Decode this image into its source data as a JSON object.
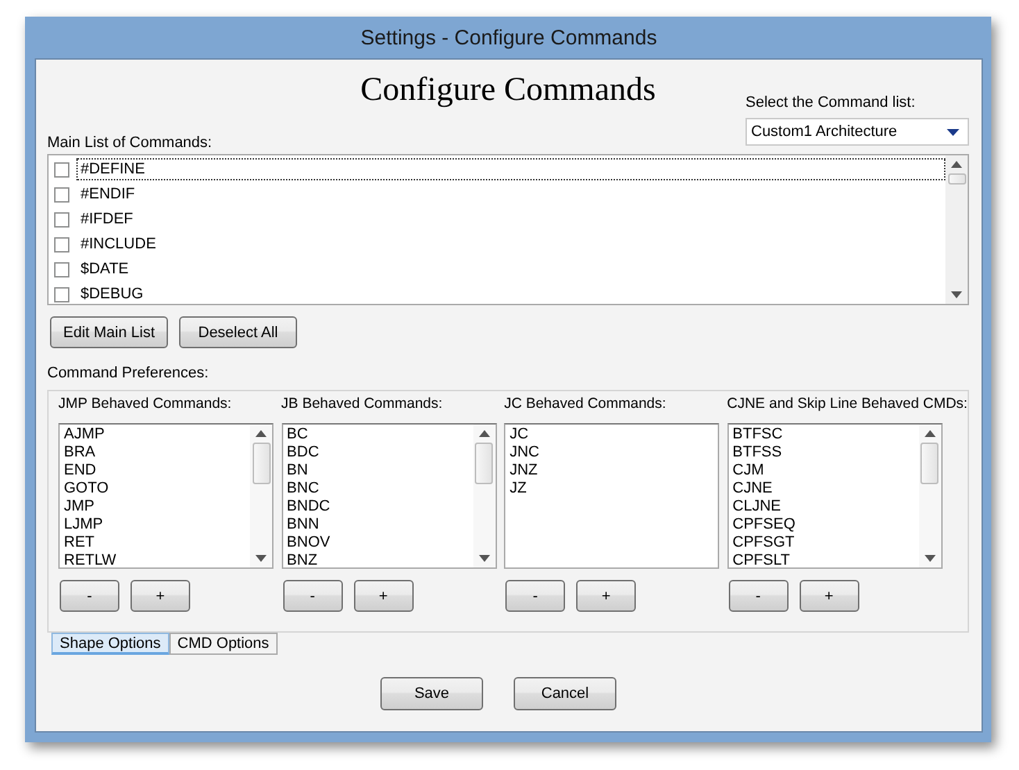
{
  "window": {
    "title": "Settings - Configure Commands"
  },
  "heading": "Configure Commands",
  "command_list": {
    "label": "Select the Command list:",
    "value": "Custom1 Architecture"
  },
  "main_list": {
    "label": "Main List of Commands:",
    "items": [
      {
        "label": "#DEFINE",
        "checked": false,
        "focused": true
      },
      {
        "label": "#ENDIF",
        "checked": false,
        "focused": false
      },
      {
        "label": "#IFDEF",
        "checked": false,
        "focused": false
      },
      {
        "label": "#INCLUDE",
        "checked": false,
        "focused": false
      },
      {
        "label": "$DATE",
        "checked": false,
        "focused": false
      },
      {
        "label": "$DEBUG",
        "checked": false,
        "focused": false
      }
    ]
  },
  "main_buttons": [
    "Edit Main List",
    "Deselect All"
  ],
  "preferences": {
    "label": "Command Preferences:",
    "groups": [
      {
        "title": "JMP Behaved Commands:",
        "scrollable": true,
        "items": [
          "AJMP",
          "BRA",
          "END",
          "GOTO",
          "JMP",
          "LJMP",
          "RET",
          "RETLW"
        ],
        "buttons": [
          "-",
          "+"
        ]
      },
      {
        "title": "JB Behaved Commands:",
        "scrollable": true,
        "items": [
          "BC",
          "BDC",
          "BN",
          "BNC",
          "BNDC",
          "BNN",
          "BNOV",
          "BNZ"
        ],
        "buttons": [
          "-",
          "+"
        ]
      },
      {
        "title": "JC Behaved Commands:",
        "scrollable": false,
        "items": [
          "JC",
          "JNC",
          "JNZ",
          "JZ"
        ],
        "buttons": [
          "-",
          "+"
        ]
      },
      {
        "title": "CJNE and Skip Line Behaved CMDs:",
        "scrollable": true,
        "items": [
          "BTFSC",
          "BTFSS",
          "CJM",
          "CJNE",
          "CLJNE",
          "CPFSEQ",
          "CPFSGT",
          "CPFSLT"
        ],
        "buttons": [
          "-",
          "+"
        ]
      }
    ]
  },
  "tabs": [
    {
      "label": "Shape Options",
      "selected": true
    },
    {
      "label": "CMD Options",
      "selected": false
    }
  ],
  "footer_buttons": [
    "Save",
    "Cancel"
  ]
}
